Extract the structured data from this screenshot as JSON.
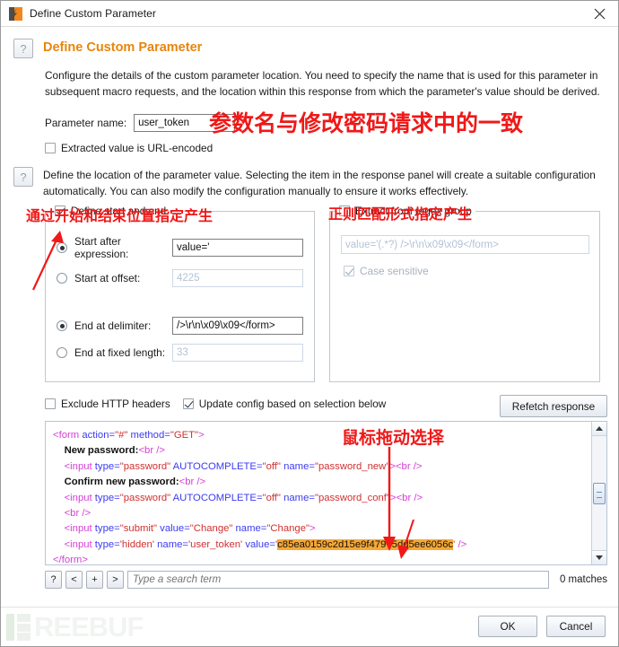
{
  "window": {
    "title": "Define Custom Parameter",
    "app_icon": "burp-suite-icon",
    "close_icon": "close-icon"
  },
  "section1": {
    "help_icon": "?",
    "heading": "Define Custom Parameter",
    "description": "Configure the details of the custom parameter location. You need to specify the name that is used for this parameter in subsequent macro requests, and the location within this response from which the parameter's value should be derived.",
    "param_label": "Parameter name:",
    "param_value": "user_token",
    "url_encoded_label": "Extracted value is URL-encoded",
    "url_encoded_checked": false
  },
  "section2": {
    "help_icon": "?",
    "description": "Define the location of the parameter value. Selecting the item in the response panel will create a suitable configuration automatically. You can also modify the configuration manually to ensure it works effectively."
  },
  "start_end_group": {
    "legend": "Define start and end",
    "enabled": true,
    "options": [
      {
        "label": "Start after expression:",
        "selected": true,
        "value": "value='",
        "disabled": false
      },
      {
        "label": "Start at offset:",
        "selected": false,
        "value": "4225",
        "disabled": true
      },
      {
        "label": "End at delimiter:",
        "selected": true,
        "value": "/>\\r\\n\\x09\\x09</form>",
        "disabled": false
      },
      {
        "label": "End at fixed length:",
        "selected": false,
        "value": "33",
        "disabled": true
      }
    ]
  },
  "regex_group": {
    "legend": "Extract from regex group",
    "enabled": false,
    "regex_value": "value='(.*?) />\\r\\n\\x09\\x09</form>",
    "case_sensitive_label": "Case sensitive",
    "case_sensitive_checked": true
  },
  "options_bar": {
    "exclude_headers_label": "Exclude HTTP headers",
    "exclude_headers_checked": false,
    "update_config_label": "Update config based on selection below",
    "update_config_checked": true,
    "refetch_label": "Refetch response"
  },
  "code_panel": {
    "lines": [
      [
        {
          "t": "tag",
          "s": "<form "
        },
        {
          "t": "attr",
          "s": "action="
        },
        {
          "t": "val",
          "s": "\"#\""
        },
        {
          "t": "attr",
          "s": " method="
        },
        {
          "t": "val",
          "s": "\"GET\""
        },
        {
          "t": "tag",
          "s": ">"
        }
      ],
      [
        {
          "t": "pad",
          "s": "    "
        },
        {
          "t": "txt",
          "s": "New password:"
        },
        {
          "t": "tag",
          "s": "<br />"
        }
      ],
      [
        {
          "t": "pad",
          "s": "    "
        },
        {
          "t": "tag",
          "s": "<input "
        },
        {
          "t": "attr",
          "s": "type="
        },
        {
          "t": "val",
          "s": "\"password\""
        },
        {
          "t": "attr",
          "s": " AUTOCOMPLETE="
        },
        {
          "t": "val",
          "s": "\"off\""
        },
        {
          "t": "attr",
          "s": " name="
        },
        {
          "t": "val",
          "s": "\"password_new\""
        },
        {
          "t": "tag",
          "s": "><br />"
        }
      ],
      [
        {
          "t": "pad",
          "s": "    "
        },
        {
          "t": "txt",
          "s": "Confirm new password:"
        },
        {
          "t": "tag",
          "s": "<br />"
        }
      ],
      [
        {
          "t": "pad",
          "s": "    "
        },
        {
          "t": "tag",
          "s": "<input "
        },
        {
          "t": "attr",
          "s": "type="
        },
        {
          "t": "val",
          "s": "\"password\""
        },
        {
          "t": "attr",
          "s": " AUTOCOMPLETE="
        },
        {
          "t": "val",
          "s": "\"off\""
        },
        {
          "t": "attr",
          "s": " name="
        },
        {
          "t": "val",
          "s": "\"password_conf\""
        },
        {
          "t": "tag",
          "s": "><br />"
        }
      ],
      [
        {
          "t": "pad",
          "s": "    "
        },
        {
          "t": "tag",
          "s": "<br />"
        }
      ],
      [
        {
          "t": "pad",
          "s": "    "
        },
        {
          "t": "tag",
          "s": "<input "
        },
        {
          "t": "attr",
          "s": "type="
        },
        {
          "t": "val",
          "s": "\"submit\""
        },
        {
          "t": "attr",
          "s": " value="
        },
        {
          "t": "val",
          "s": "\"Change\""
        },
        {
          "t": "attr",
          "s": " name="
        },
        {
          "t": "val",
          "s": "\"Change\""
        },
        {
          "t": "tag",
          "s": ">"
        }
      ],
      [
        {
          "t": "pad",
          "s": "    "
        },
        {
          "t": "tag",
          "s": "<input "
        },
        {
          "t": "attr",
          "s": "type="
        },
        {
          "t": "val",
          "s": "'hidden'"
        },
        {
          "t": "attr",
          "s": " name="
        },
        {
          "t": "val",
          "s": "'user_token'"
        },
        {
          "t": "attr",
          "s": " value="
        },
        {
          "t": "val",
          "s": "'"
        },
        {
          "t": "hl",
          "s": "c85ea0159c2d15e9f47975dd5ee6056c"
        },
        {
          "t": "val",
          "s": "'"
        },
        {
          "t": "tag",
          "s": " />"
        }
      ],
      [
        {
          "t": "tag",
          "s": "</form>"
        }
      ]
    ],
    "scrollbar": {
      "up_icon": "scroll-up-icon",
      "down_icon": "scroll-down-icon"
    }
  },
  "search_bar": {
    "help_label": "?",
    "prev_label": "<",
    "add_label": "+",
    "next_label": ">",
    "placeholder": "Type a search term",
    "value": "",
    "matches": "0 matches"
  },
  "footer": {
    "ok_label": "OK",
    "cancel_label": "Cancel"
  },
  "watermark": {
    "text": "REEBUF"
  },
  "annotations": {
    "param_name": "参数名与修改密码请求中的一致",
    "start_end": "通过开始和结束位置指定产生",
    "regex": "正则匹配形式指定产生",
    "drag_select": "鼠标拖动选择"
  },
  "colors": {
    "accent_orange": "#e8850d",
    "annotation_red": "#f01818",
    "highlight": "#f7a834"
  }
}
